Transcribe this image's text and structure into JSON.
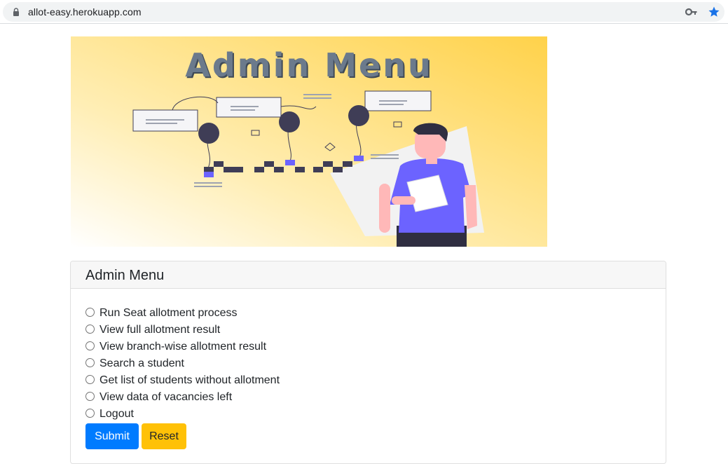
{
  "browser": {
    "url": "allot-easy.herokuapp.com",
    "icons": [
      "lock-icon",
      "key-icon",
      "star-icon"
    ]
  },
  "banner": {
    "title": "Admin Menu",
    "colors": {
      "gradient_start": "#ffffff",
      "gradient_end": "#ffd24a",
      "accent": "#6c63ff"
    }
  },
  "card": {
    "title": "Admin Menu",
    "options": [
      "Run Seat allotment process",
      "View full allotment result",
      "View branch-wise allotment result",
      "Search a student",
      "Get list of students without allotment",
      "View data of vacancies left",
      "Logout"
    ],
    "submit_label": "Submit",
    "reset_label": "Reset",
    "colors": {
      "submit": "#007bff",
      "reset": "#ffc107"
    }
  }
}
